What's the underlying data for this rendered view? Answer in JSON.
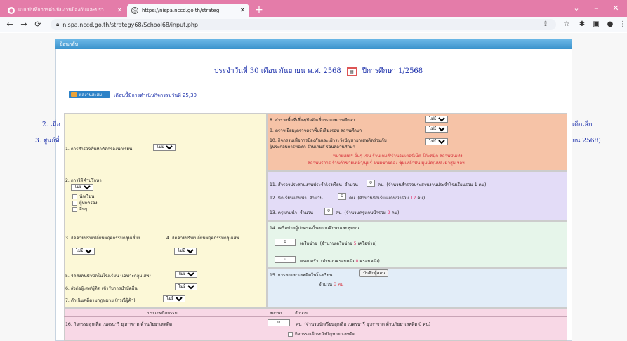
{
  "browser": {
    "tabs": [
      {
        "title": "แบบบันทึกการดำเนินงานป้องกันและปรา",
        "active": false
      },
      {
        "title": "https://nispa.nccd.go.th/strateg",
        "active": true
      }
    ],
    "url": "nispa.nccd.go.th/strategy68/School68/input.php"
  },
  "page": {
    "menu": "ย้อนกลับ",
    "date_line": "ประจำวันที่ 30 เดือน กันยายน พ.ศ. 2568",
    "year_line": "ปีการศึกษา 1/2568",
    "result_button": "ผลงานสะสม",
    "month_note": "เดือนนี้มีการดำเนินกิจกรรมวันที่ 25,30",
    "side_left_1": "2. เมื่อ",
    "side_left_2": "3. ศูนย์ที่",
    "side_right_1": "เด็กเล็ก",
    "side_right_2": "ยน 2568)"
  },
  "form": {
    "q1_label": "1. การสำรวจค้นหาคัดกรองนักเรียน",
    "q1_value": "ไม่มี",
    "q8_label": "8. สำรวจพื้นที่เสี่ยง/ปัจจัยเสี่ยงรอบสถานศึกษา",
    "q8_value": "ไม่มี",
    "q9_label": "9. ตรวจเยี่ยม/ตรวจตราพื้นที่เสี่ยงรอบ สถานศึกษา",
    "q9_value": "ไม่มี",
    "q10_label_a": "10. กิจกรรมเพื่อการป้องกันและเฝ้าระวังปัญหายาเสพติดร่วมกับ",
    "q10_label_b": "ผู้ประกอบการหอพัก ร้านเกมส์ รอบสถานศึกษา",
    "q10_value": "ไม่มี",
    "q10_note_a": "หมายเหตุ* อื่นๆ เช่น ร้านเกมส์/ร้านอินเตอร์เน็ต โต๊ะสนุ๊ก สถานบันเทิง",
    "q10_note_b": "สถานบริการ ร้านค้าขายเหล้า/บุหรี่ ขนมขายดอง ซุ้มเหล้าปั่น มุมมืด/แหล่งมั่วสุม ฯลฯ",
    "q2_label": "2. การให้คำปรึกษา",
    "q2_value": "ไม่มี",
    "q2_opts": [
      "นักเรียน",
      "ผู้ปกครอง",
      "อื่นๆ"
    ],
    "q11_label": "11. สำรวจประสานงานประจำโรงเรียน",
    "q11_qty_label": "จำนวน",
    "q11_value": "0",
    "q11_unit": "คน",
    "q11_total_a": "(จำนวนสำรวจประสานงานประจำโรงเรียนรวม",
    "q11_total_n": "1",
    "q11_total_u": "คน)",
    "q12_label": "12. นักเรียนแกนนำ",
    "q12_qty_label": "จำนวน",
    "q12_value": "0",
    "q12_unit": "คน",
    "q12_total_a": "(จำนวนนักเรียนแกนนำรวม",
    "q12_total_n": "12",
    "q12_total_u": "คน)",
    "q13_label": "13. ครูแกนนำ",
    "q13_qty_label": "จำนวน",
    "q13_value": "0",
    "q13_unit": "คน",
    "q13_total_a": "(จำนวนครูแกนนำรวม",
    "q13_total_n": "2",
    "q13_total_u": "คน)",
    "q3_label": "3. จัดค่ายปรับเปลี่ยนพฤติกรรมกลุ่มเสี่ยง",
    "q3_value": "ไม่มี",
    "q4_label": "4. จัดค่ายปรับเปลี่ยนพฤติกรรมกลุ่มเสพ",
    "q4_value": "ไม่มี",
    "q14_label": "14. เครือข่ายผู้ปกครองในสถานศึกษาและชุมชน",
    "q14_net_value": "0",
    "q14_net_unit": "เครือข่าย",
    "q14_net_total_a": "(จำนวนเครือข่าย",
    "q14_net_total_n": "5",
    "q14_net_total_u": "เครือข่าย)",
    "q14_fam_value": "0",
    "q14_fam_unit": "ครอบครัว",
    "q14_fam_total_a": "(จำนวนครอบครัว",
    "q14_fam_total_n": "0",
    "q14_fam_total_u": "ครอบครัว)",
    "q5_label": "5. จัดส่งคนบำบัดในโรงเรียน (เฉพาะกลุ่มเสพ)",
    "q5_value": "ไม่มี",
    "q6_label": "6. ส่งต่อผู้เสพ/ผู้ติด เข้ารับการบำบัดอื่น",
    "q6_value": "ไม่มี",
    "q7_label": "7. ดำเนินคดีตามกฎหมาย (กรณีผู้ค้า)",
    "q7_value": "ไม่มี",
    "q15_label": "15. การสอนยาเสพติดในโรงเรียน",
    "q15_button": "บันทึกผู้สอน",
    "q15_count_label": "จำนวน",
    "q15_count": "0",
    "q15_count_unit": "คน",
    "table_head_activity": "ประเภทกิจกรรม",
    "table_head_status": "สถานะ",
    "table_head_qty": "จำนวน",
    "q16_label": "16. กิจกรรมลูกเสือ เนตรนารี ยุวกาชาด ต้านภัยยาเสพติด",
    "q16_value": "0",
    "q16_unit": "คน",
    "q16_total": "(จำนวนนักเรียนลูกเสือ เนตรนารี ยุวกาชาด ต้านภัยยาเสพติด   0  คน)",
    "q16_sub": "กิจกรรมเฝ้าระวังปัญหายาเสพติด"
  }
}
